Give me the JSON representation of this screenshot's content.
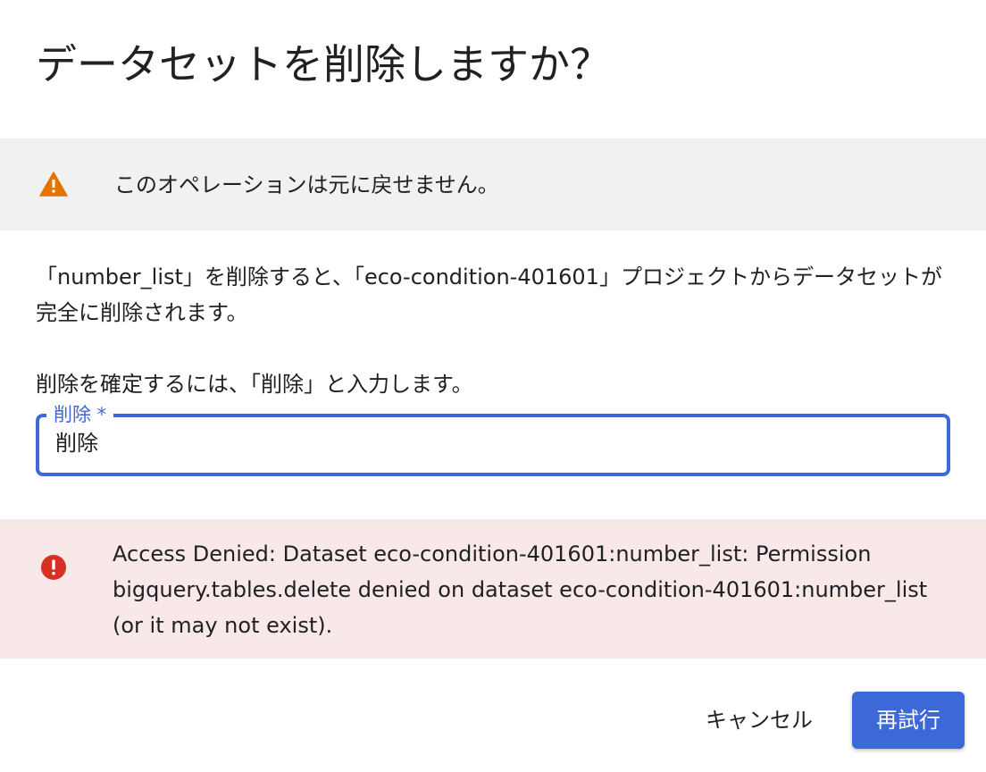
{
  "dialog": {
    "title": "データセットを削除しますか？"
  },
  "warning": {
    "icon": "warning-triangle-icon",
    "icon_color": "#e37400",
    "text": "このオペレーションは元に戻せません。"
  },
  "description": {
    "text": "「number_list」を削除すると、「eco-condition-401601」プロジェクトからデータセットが完全に削除されます。"
  },
  "confirm": {
    "instruction": "削除を確定するには、「削除」と入力します。",
    "field_label": "削除 *",
    "field_value": "削除"
  },
  "error": {
    "icon": "error-circle-icon",
    "icon_color": "#d93025",
    "text": "Access Denied: Dataset eco-condition-401601:number_list: Permission bigquery.tables.delete denied on dataset eco-condition-401601:number_list (or it may not exist)."
  },
  "actions": {
    "cancel_label": "キャンセル",
    "retry_label": "再試行",
    "accent_color": "#3c68d8"
  }
}
